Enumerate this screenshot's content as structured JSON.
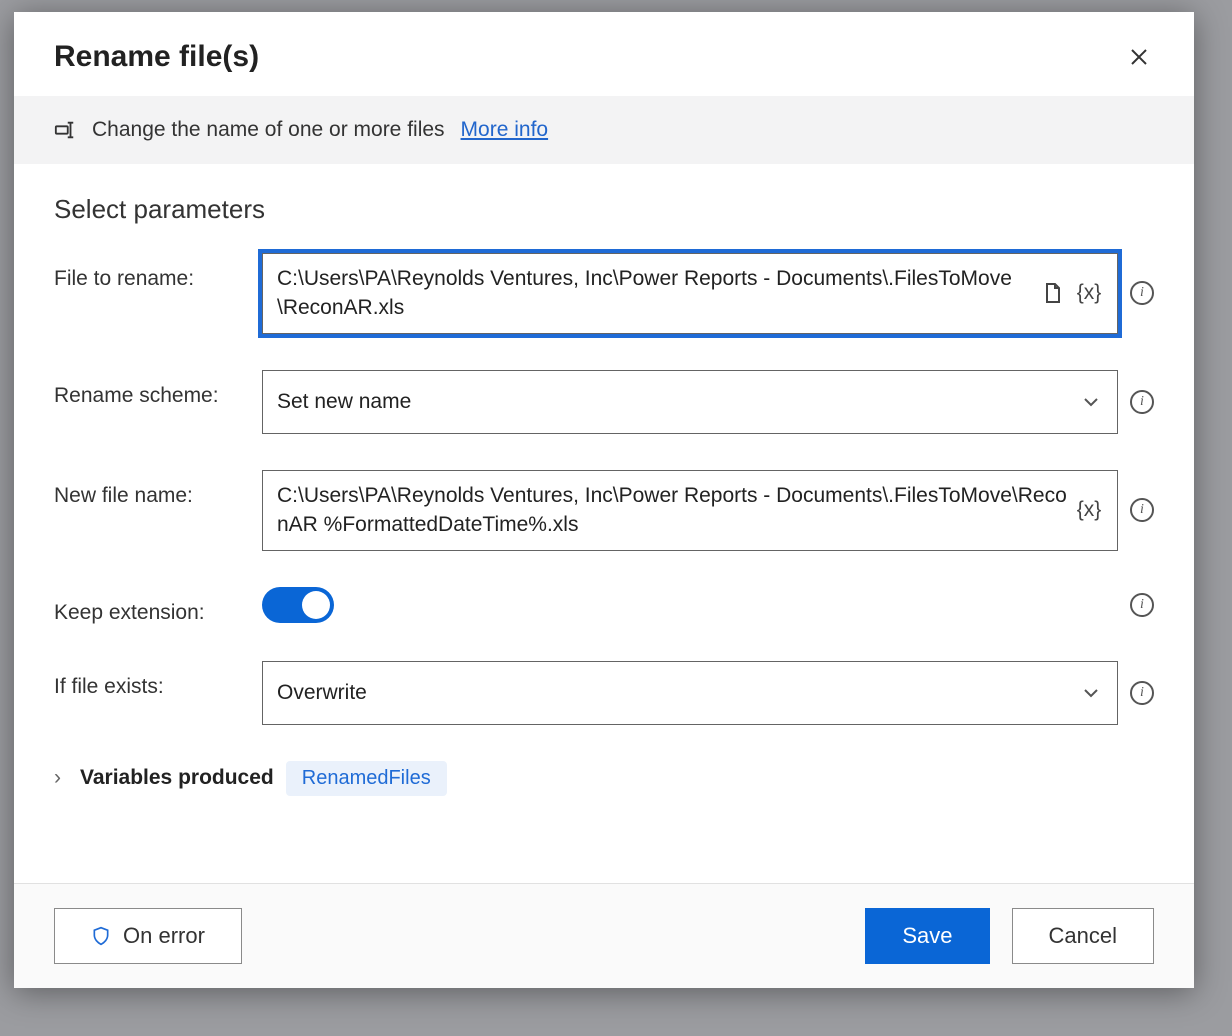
{
  "dialog": {
    "title": "Rename file(s)",
    "info_text": "Change the name of one or more files",
    "more_info": "More info",
    "section_title": "Select parameters"
  },
  "fields": {
    "file_to_rename": {
      "label": "File to rename:",
      "value": "C:\\Users\\PA\\Reynolds Ventures, Inc\\Power Reports - Documents\\.FilesToMove\\ReconAR.xls"
    },
    "rename_scheme": {
      "label": "Rename scheme:",
      "value": "Set new name"
    },
    "new_file_name": {
      "label": "New file name:",
      "value": "C:\\Users\\PA\\Reynolds Ventures, Inc\\Power Reports - Documents\\.FilesToMove\\ReconAR %FormattedDateTime%.xls"
    },
    "keep_extension": {
      "label": "Keep extension:",
      "value": true
    },
    "if_file_exists": {
      "label": "If file exists:",
      "value": "Overwrite"
    }
  },
  "variables": {
    "label": "Variables produced",
    "chip": "RenamedFiles"
  },
  "footer": {
    "on_error": "On error",
    "save": "Save",
    "cancel": "Cancel"
  }
}
